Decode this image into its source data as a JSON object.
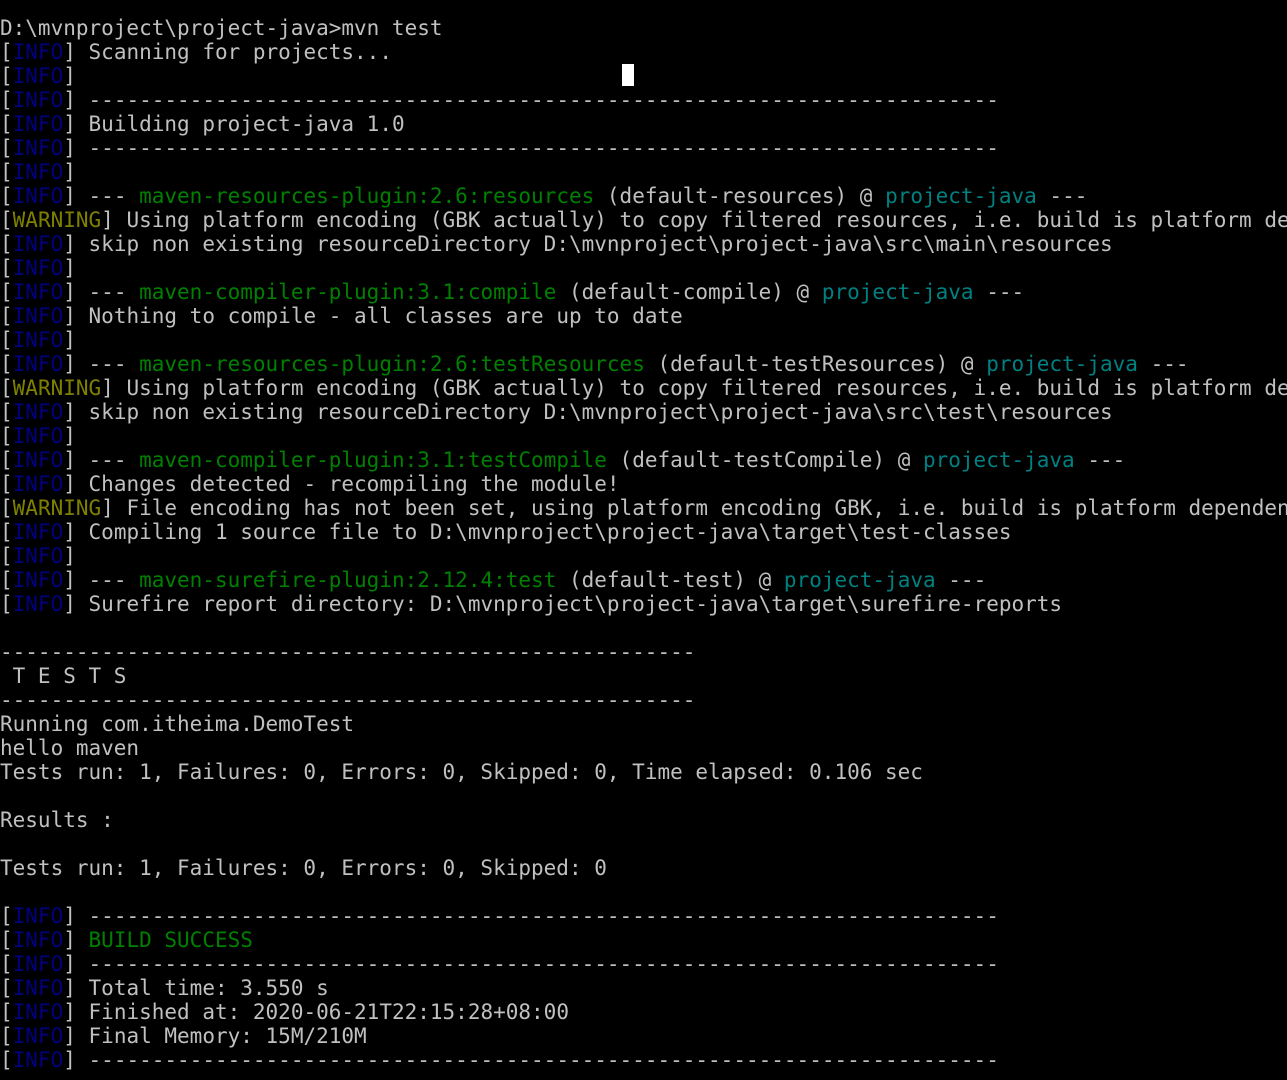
{
  "console": {
    "lines": [
      {
        "text": "D:\\mvnproject\\project-java>mvn test"
      },
      {
        "level": "INFO",
        "text": " Scanning for projects..."
      },
      {
        "level": "INFO",
        "text": ""
      },
      {
        "level": "INFO",
        "text": " ------------------------------------------------------------------------"
      },
      {
        "level": "INFO",
        "text": " Building project-java 1.0"
      },
      {
        "level": "INFO",
        "text": " ------------------------------------------------------------------------"
      },
      {
        "level": "INFO",
        "text": ""
      },
      {
        "level": "INFO",
        "pre": " --- ",
        "plugin": "maven-resources-plugin:2.6:resources",
        "mid": " (default-resources) @ ",
        "artifact": "project-java",
        "post": " ---"
      },
      {
        "level": "WARNING",
        "text": " Using platform encoding (GBK actually) to copy filtered resources, i.e. build is platform dependent!"
      },
      {
        "level": "INFO",
        "text": " skip non existing resourceDirectory D:\\mvnproject\\project-java\\src\\main\\resources"
      },
      {
        "level": "INFO",
        "text": ""
      },
      {
        "level": "INFO",
        "pre": " --- ",
        "plugin": "maven-compiler-plugin:3.1:compile",
        "mid": " (default-compile) @ ",
        "artifact": "project-java",
        "post": " ---"
      },
      {
        "level": "INFO",
        "text": " Nothing to compile - all classes are up to date"
      },
      {
        "level": "INFO",
        "text": ""
      },
      {
        "level": "INFO",
        "pre": " --- ",
        "plugin": "maven-resources-plugin:2.6:testResources",
        "mid": " (default-testResources) @ ",
        "artifact": "project-java",
        "post": " ---"
      },
      {
        "level": "WARNING",
        "text": " Using platform encoding (GBK actually) to copy filtered resources, i.e. build is platform dependent!"
      },
      {
        "level": "INFO",
        "text": " skip non existing resourceDirectory D:\\mvnproject\\project-java\\src\\test\\resources"
      },
      {
        "level": "INFO",
        "text": ""
      },
      {
        "level": "INFO",
        "pre": " --- ",
        "plugin": "maven-compiler-plugin:3.1:testCompile",
        "mid": " (default-testCompile) @ ",
        "artifact": "project-java",
        "post": " ---"
      },
      {
        "level": "INFO",
        "text": " Changes detected - recompiling the module!"
      },
      {
        "level": "WARNING",
        "text": " File encoding has not been set, using platform encoding GBK, i.e. build is platform dependent!"
      },
      {
        "level": "INFO",
        "text": " Compiling 1 source file to D:\\mvnproject\\project-java\\target\\test-classes"
      },
      {
        "level": "INFO",
        "text": ""
      },
      {
        "level": "INFO",
        "pre": " --- ",
        "plugin": "maven-surefire-plugin:2.12.4:test",
        "mid": " (default-test) @ ",
        "artifact": "project-java",
        "post": " ---"
      },
      {
        "level": "INFO",
        "text": " Surefire report directory: D:\\mvnproject\\project-java\\target\\surefire-reports"
      },
      {
        "text": ""
      },
      {
        "text": "-------------------------------------------------------"
      },
      {
        "text": " T E S T S"
      },
      {
        "text": "-------------------------------------------------------"
      },
      {
        "text": "Running com.itheima.DemoTest"
      },
      {
        "text": "hello maven"
      },
      {
        "text": "Tests run: 1, Failures: 0, Errors: 0, Skipped: 0, Time elapsed: 0.106 sec"
      },
      {
        "text": ""
      },
      {
        "text": "Results :"
      },
      {
        "text": ""
      },
      {
        "text": "Tests run: 1, Failures: 0, Errors: 0, Skipped: 0"
      },
      {
        "text": ""
      },
      {
        "level": "INFO",
        "text": " ------------------------------------------------------------------------"
      },
      {
        "level": "INFO",
        "success": " BUILD SUCCESS"
      },
      {
        "level": "INFO",
        "text": " ------------------------------------------------------------------------"
      },
      {
        "level": "INFO",
        "text": " Total time: 3.550 s"
      },
      {
        "level": "INFO",
        "text": " Finished at: 2020-06-21T22:15:28+08:00"
      },
      {
        "level": "INFO",
        "text": " Final Memory: 15M/210M"
      },
      {
        "level": "INFO",
        "text": " ------------------------------------------------------------------------"
      }
    ]
  },
  "colors": {
    "background": "#000000",
    "text": "#c0c0c0",
    "info_level": "#000080",
    "warning_level": "#808000",
    "plugin": "#008000",
    "artifact": "#008080",
    "success": "#008000",
    "cursor": "#ffffff"
  }
}
